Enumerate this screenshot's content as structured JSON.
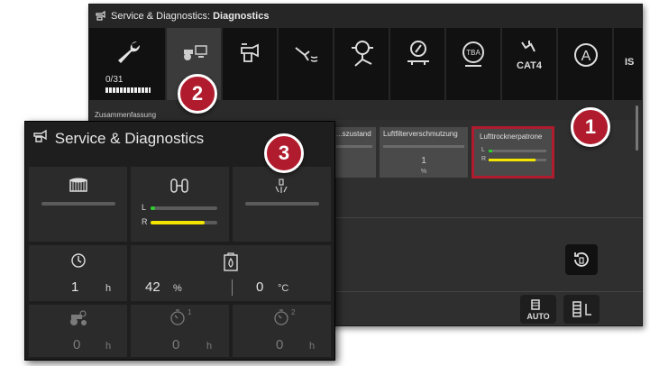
{
  "main_window": {
    "title_prefix": "Service & Diagnostics: ",
    "title_bold": "Diagnostics",
    "tabs": [
      {
        "icon": "wrench-icon",
        "counter": "0/31"
      },
      {
        "icon": "tractor-monitor-icon"
      },
      {
        "icon": "oil-can-icon"
      },
      {
        "icon": "sprayer-icon"
      },
      {
        "icon": "hitch-icon"
      },
      {
        "icon": "trailer-brake-icon"
      },
      {
        "icon": "tba-icon",
        "label": "TBA"
      },
      {
        "icon": "cat4-icon",
        "label": "CAT4"
      },
      {
        "icon": "auto-mode-icon",
        "label": "A"
      },
      {
        "icon": "is-icon",
        "label": "IS"
      }
    ],
    "summary_label": "Zusammenfassung",
    "cards": [
      {
        "label": "...szustand"
      },
      {
        "label": "Luftfilterverschmutzung",
        "value": "1",
        "unit": "%"
      },
      {
        "label": "Lufttrocknerpatrone",
        "l_label": "L",
        "r_label": "R",
        "l_level": 0.05,
        "r_level": 0.8
      }
    ],
    "buttons": [
      {
        "icon": "reset-icon"
      },
      {
        "icon": "auto-filter-icon",
        "label": "AUTO"
      },
      {
        "icon": "filter-service-icon"
      }
    ]
  },
  "badges": {
    "b1": "1",
    "b2": "2",
    "b3": "3"
  },
  "overlay": {
    "title": "Service & Diagnostics",
    "air_dryer": {
      "l_label": "L",
      "r_label": "R",
      "l_level": 0.05,
      "r_level": 0.8
    },
    "hours": {
      "value": "1",
      "unit": "h"
    },
    "fuel_percent": {
      "value": "42",
      "unit": "%"
    },
    "temperature": {
      "value": "0",
      "unit": "°C"
    },
    "service_1": {
      "value": "0",
      "unit": "h",
      "sup": "1"
    },
    "service_2": {
      "value": "0",
      "unit": "h",
      "sup": "1"
    },
    "service_3": {
      "value": "0",
      "unit": "h",
      "sup": "2"
    }
  },
  "colors": {
    "badge": "#b01c2e",
    "level_l": "#2ecc2e",
    "level_r": "#f2e600"
  }
}
